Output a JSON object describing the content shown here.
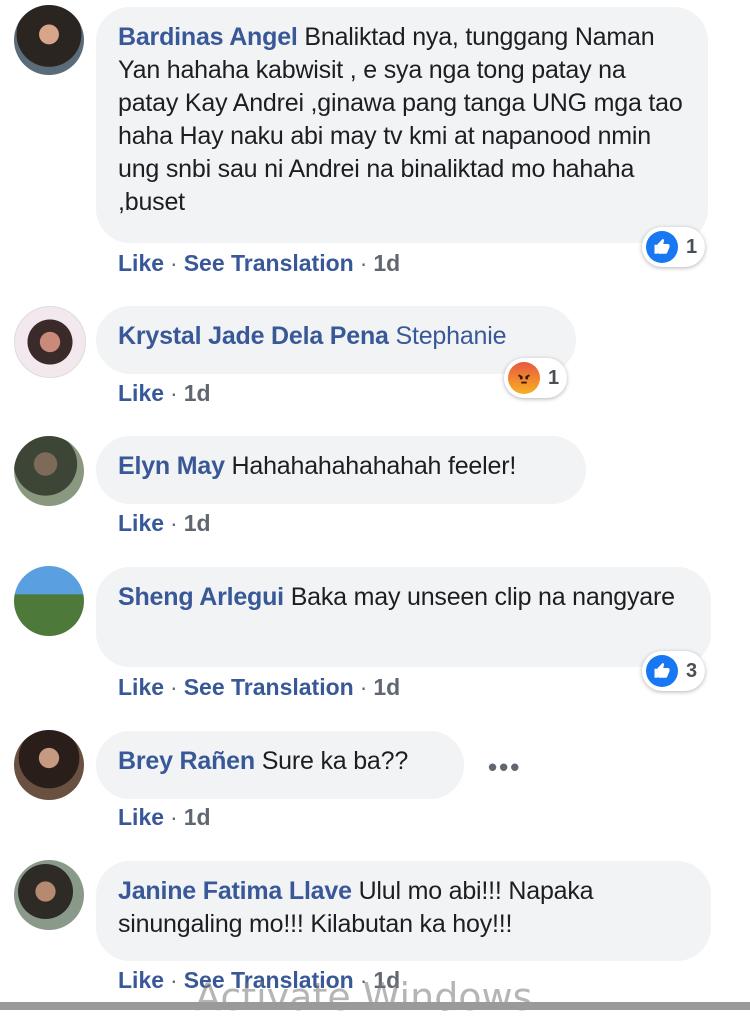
{
  "actions": {
    "like": "Like",
    "see_translation": "See Translation",
    "separator": "·"
  },
  "comments": [
    {
      "author": "Bardinas Angel",
      "text": "Bnaliktad nya, tunggang Naman Yan hahaha kabwisit , e sya nga tong patay na patay Kay Andrei ,ginawa pang tanga UNG mga tao haha Hay naku abi may tv kmi at napanood nmin ung snbi sau ni Andrei na binaliktad mo hahaha ,buset",
      "time": "1d",
      "reaction": {
        "icon": "like-icon",
        "count": "1"
      }
    },
    {
      "author": "Krystal Jade Dela Pena",
      "text": "Stephanie",
      "time": "1d",
      "reaction": {
        "icon": "angry-icon",
        "count": "1"
      }
    },
    {
      "author": "Elyn May",
      "text": "Hahahahahahahah feeler!",
      "time": "1d"
    },
    {
      "author": "Sheng Arlegui",
      "text": "Baka may unseen clip na nangyare",
      "time": "1d",
      "reaction": {
        "icon": "like-icon",
        "count": "3"
      }
    },
    {
      "author": "Brey Rañen",
      "text": "Sure ka ba??",
      "time": "1d",
      "more": "•••"
    },
    {
      "author": "Janine Fatima Llave",
      "text": "Ulul mo abi!!! Napaka sinungaling mo!!! Kilabutan ka hoy!!!",
      "time": "1d"
    }
  ],
  "overlay": {
    "watermark": "Activate Windows"
  },
  "colors": {
    "author": "#385898",
    "bubble": "#f2f3f5",
    "like_blue": "#1877f2"
  }
}
